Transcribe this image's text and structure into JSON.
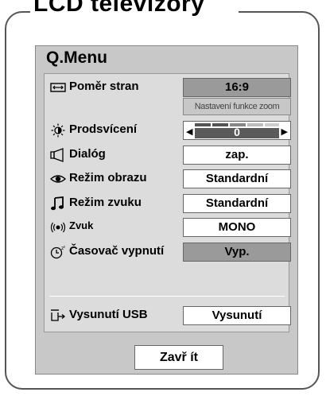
{
  "page_title": "LCD televizory",
  "menu": {
    "title": "Q.Menu",
    "items": [
      {
        "icon": "aspect-ratio-icon",
        "label": "Poměr stran",
        "value": "16:9",
        "sub_option": "Nastavení funkce zoom"
      },
      {
        "icon": "backlight-icon",
        "label": "Prodsvícení",
        "value": "0"
      },
      {
        "icon": "speaker-icon",
        "label": "Dialóg",
        "value": "zap."
      },
      {
        "icon": "eye-icon",
        "label": "Režim obrazu",
        "value": "Standardní"
      },
      {
        "icon": "music-note-icon",
        "label": "Režim zvuku",
        "value": "Standardní"
      },
      {
        "icon": "sound-waves-icon",
        "label": "Zvuk",
        "value": "MONO"
      },
      {
        "icon": "sleep-timer-icon",
        "label": "Časovač vypnutí",
        "value": "Vyp."
      },
      {
        "icon": "usb-eject-icon",
        "label": "Vysunutí USB",
        "value": "Vysunutí"
      }
    ],
    "close_label": "Zavř ít"
  }
}
